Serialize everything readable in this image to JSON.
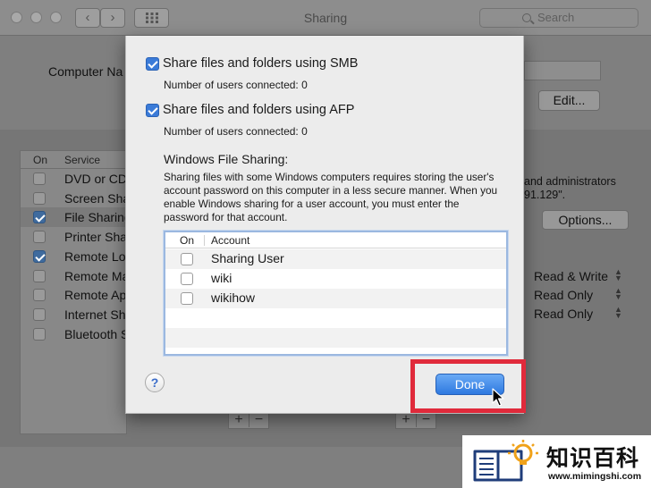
{
  "window": {
    "title": "Sharing",
    "search_placeholder": "Search",
    "back_glyph": "‹",
    "forward_glyph": "›",
    "computer_name_label": "Computer Na",
    "edit_button": "Edit..."
  },
  "services": {
    "header_on": "On",
    "header_service": "Service",
    "items": [
      {
        "label": "DVD or CD",
        "checked": false
      },
      {
        "label": "Screen Sha",
        "checked": false
      },
      {
        "label": "File Sharing",
        "checked": true
      },
      {
        "label": "Printer Sha",
        "checked": false
      },
      {
        "label": "Remote Lo",
        "checked": true
      },
      {
        "label": "Remote Ma",
        "checked": false
      },
      {
        "label": "Remote Ap",
        "checked": false
      },
      {
        "label": "Internet Sh",
        "checked": false
      },
      {
        "label": "Bluetooth S",
        "checked": false
      }
    ]
  },
  "right_info": {
    "line1": "and administrators",
    "line2": "91.129\".",
    "options_button": "Options...",
    "permissions": [
      "Read & Write",
      "Read Only",
      "Read Only"
    ]
  },
  "dialog": {
    "smb_label": "Share files and folders using SMB",
    "smb_count": "Number of users connected: 0",
    "afp_label": "Share files and folders using AFP",
    "afp_count": "Number of users connected: 0",
    "wfs_title": "Windows File Sharing:",
    "wfs_description": "Sharing files with some Windows computers requires storing the user's account password on this computer in a less secure manner.  When you enable Windows sharing for a user account, you must enter the password for that account.",
    "table_header_on": "On",
    "table_header_account": "Account",
    "accounts": [
      "Sharing User",
      "wiki",
      "wikihow"
    ],
    "help_label": "?",
    "done_button": "Done"
  },
  "watermark": {
    "brand": "知识百科",
    "url": "www.mimingshi.com"
  },
  "colors": {
    "accent": "#3b7bd8",
    "highlight": "#e02a3b"
  }
}
